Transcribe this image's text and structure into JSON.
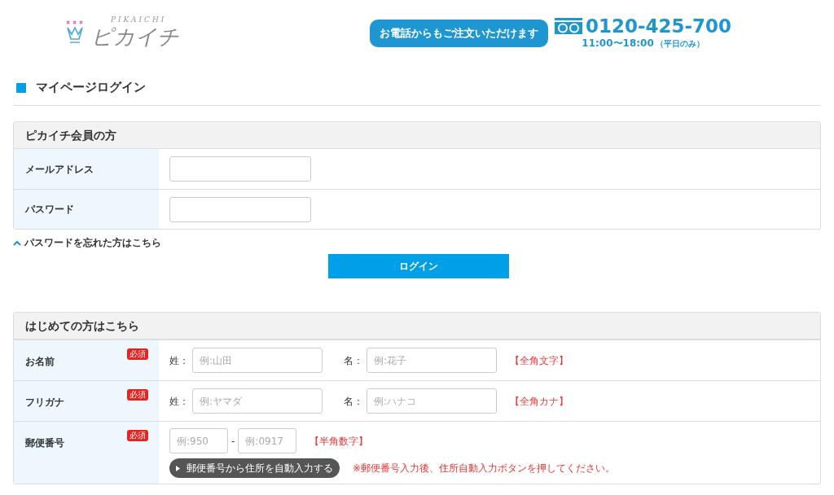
{
  "header": {
    "logo_small": "PIKAICHI",
    "logo": "ピカイチ",
    "phone_button": "お電話からもご注文いただけます",
    "phone": "0120-425-700",
    "hours": "11:00〜18:00",
    "hours_note": "（平日のみ）"
  },
  "page_title": "マイページログイン",
  "member": {
    "heading": "ピカイチ会員の方",
    "fields": [
      {
        "label": "メールアドレス"
      },
      {
        "label": "パスワード"
      }
    ],
    "forgot_link": "パスワードを忘れた方はこちら",
    "login_button": "ログイン"
  },
  "new_user": {
    "heading": "はじめての方はこちら",
    "rows": [
      {
        "kind": "name",
        "label": "お名前",
        "required": "必須",
        "parts": [
          {
            "prefix": "姓：",
            "placeholder": "例:山田"
          },
          {
            "prefix": "名：",
            "placeholder": "例:花子"
          }
        ],
        "note": "【全角文字】"
      },
      {
        "kind": "name",
        "label": "フリガナ",
        "required": "必須",
        "parts": [
          {
            "prefix": "姓：",
            "placeholder": "例:ヤマダ"
          },
          {
            "prefix": "名：",
            "placeholder": "例:ハナコ"
          }
        ],
        "note": "【全角カナ】"
      },
      {
        "kind": "zip",
        "label": "郵便番号",
        "required": "必須",
        "parts": [
          {
            "placeholder": "例:950"
          },
          {
            "placeholder": "例:0917"
          }
        ],
        "separator": "-",
        "note": "【半角数字】",
        "button": "郵便番号から住所を自動入力する",
        "hint": "※郵便番号入力後、住所自動入力ボタンを押してください。"
      }
    ]
  }
}
